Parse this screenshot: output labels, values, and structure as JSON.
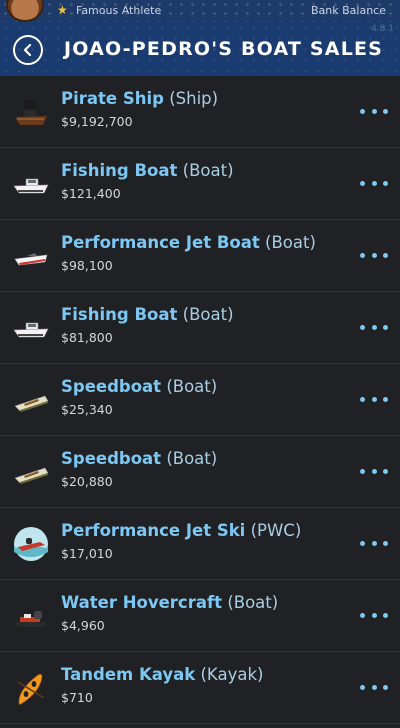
{
  "status": {
    "career": "Famous Athlete",
    "bank_label": "Bank Balance",
    "version": "4.8.1"
  },
  "header": {
    "title": "Joao-Pedro's Boat Sales"
  },
  "colors": {
    "accent": "#7dc7f3",
    "header_bg": "#1a3b70",
    "background": "#202124"
  },
  "listings": [
    {
      "name": "Pirate Ship",
      "type": "(Ship)",
      "price": "$9,192,700",
      "icon": "pirate-ship-icon"
    },
    {
      "name": "Fishing Boat",
      "type": "(Boat)",
      "price": "$121,400",
      "icon": "fishing-boat-icon"
    },
    {
      "name": "Performance Jet Boat",
      "type": "(Boat)",
      "price": "$98,100",
      "icon": "jet-boat-icon"
    },
    {
      "name": "Fishing Boat",
      "type": "(Boat)",
      "price": "$81,800",
      "icon": "fishing-boat-icon"
    },
    {
      "name": "Speedboat",
      "type": "(Boat)",
      "price": "$25,340",
      "icon": "speedboat-icon"
    },
    {
      "name": "Speedboat",
      "type": "(Boat)",
      "price": "$20,880",
      "icon": "speedboat-icon"
    },
    {
      "name": "Performance Jet Ski",
      "type": "(PWC)",
      "price": "$17,010",
      "icon": "jet-ski-icon"
    },
    {
      "name": "Water Hovercraft",
      "type": "(Boat)",
      "price": "$4,960",
      "icon": "hovercraft-icon"
    },
    {
      "name": "Tandem Kayak",
      "type": "(Kayak)",
      "price": "$710",
      "icon": "kayak-icon"
    }
  ]
}
